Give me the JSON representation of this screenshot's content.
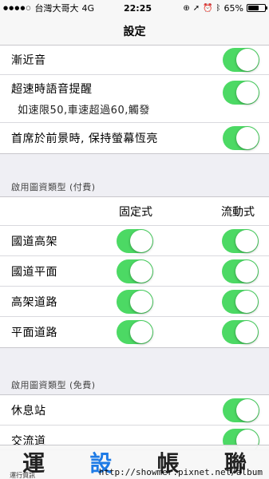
{
  "status": {
    "carrier": "台灣大哥大",
    "network": "4G",
    "time": "22:25",
    "icons": [
      "lock-rotation-icon",
      "location-icon",
      "alarm-icon",
      "bluetooth-icon"
    ],
    "battery": "65%",
    "battery_level": 0.65
  },
  "nav": {
    "title": "設定"
  },
  "group1": {
    "rows": [
      {
        "label": "漸近音",
        "on": true
      },
      {
        "label": "超速時語音提醒",
        "sublabel": "如速限50,車速超過60,觸發",
        "on": true
      },
      {
        "label": "首席於前景時, 保持螢幕恆亮",
        "on": true
      }
    ]
  },
  "section_paid": {
    "header": "啟用圖資類型 (付費)",
    "col_fixed": "固定式",
    "col_mobile": "流動式",
    "rows": [
      {
        "label": "國道高架",
        "fixed_on": true,
        "mobile_on": true
      },
      {
        "label": "國道平面",
        "fixed_on": true,
        "mobile_on": true
      },
      {
        "label": "高架道路",
        "fixed_on": true,
        "mobile_on": true
      },
      {
        "label": "平面道路",
        "fixed_on": true,
        "mobile_on": true
      }
    ]
  },
  "section_free": {
    "header": "啟用圖資類型 (免費)",
    "rows": [
      {
        "label": "休息站",
        "on": true
      },
      {
        "label": "交流道",
        "on": true
      }
    ]
  },
  "tabbar": {
    "tabs": [
      {
        "label": "運",
        "sublabel": "運行資訊",
        "active": false
      },
      {
        "label": "設",
        "active": true
      },
      {
        "label": "帳",
        "active": false
      },
      {
        "label": "聯",
        "active": false
      }
    ]
  },
  "watermark": "http://showmer.pixnet.net/album",
  "colors": {
    "toggle_on": "#4cd964",
    "active_tab": "#1e7be6",
    "background": "#efeff4"
  }
}
